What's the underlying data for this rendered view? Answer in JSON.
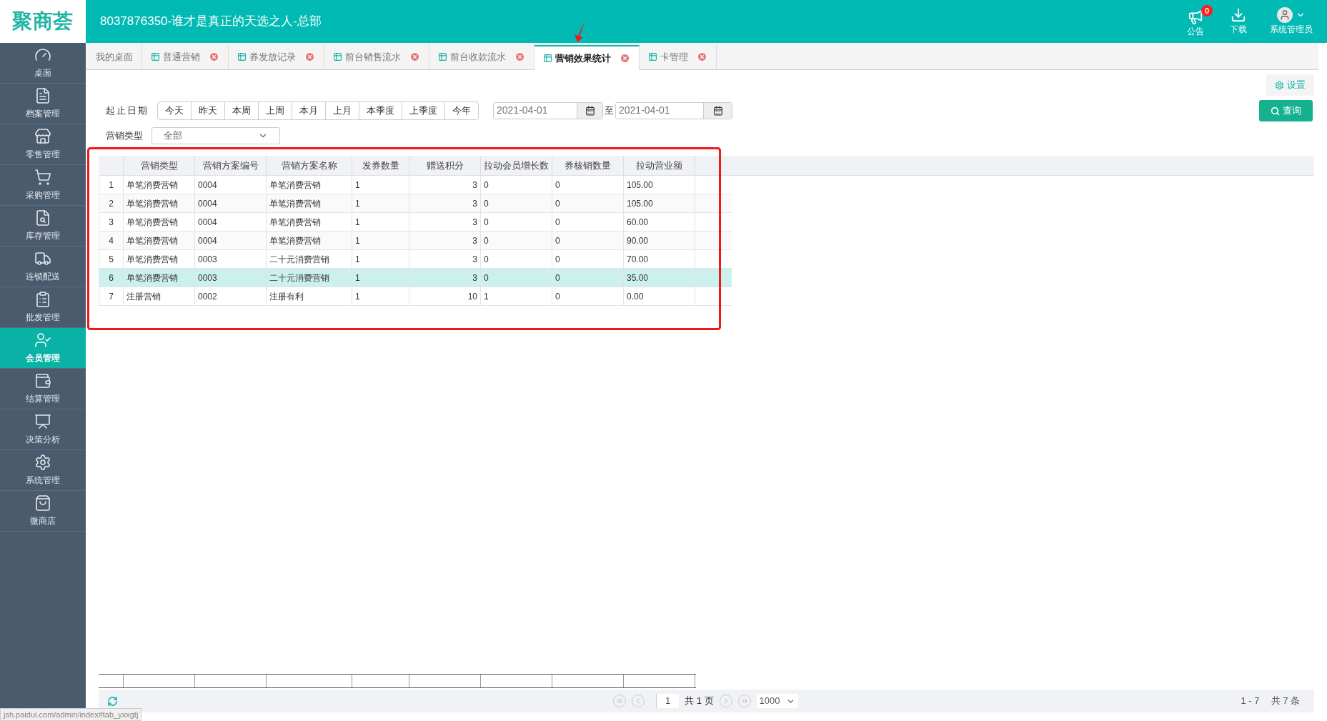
{
  "header": {
    "logo": "聚商荟",
    "title": "8037876350-谁才是真正的天选之人-总部",
    "notice": {
      "label": "公告",
      "badge": "0"
    },
    "download": "下载",
    "user": "系统管理员"
  },
  "sidebar": {
    "items": [
      {
        "label": "桌面",
        "selected": false
      },
      {
        "label": "档案管理",
        "selected": false
      },
      {
        "label": "零售管理",
        "selected": false
      },
      {
        "label": "采购管理",
        "selected": false
      },
      {
        "label": "库存管理",
        "selected": false
      },
      {
        "label": "连锁配送",
        "selected": false
      },
      {
        "label": "批发管理",
        "selected": false
      },
      {
        "label": "会员管理",
        "selected": true
      },
      {
        "label": "结算管理",
        "selected": false
      },
      {
        "label": "决策分析",
        "selected": false
      },
      {
        "label": "系统管理",
        "selected": false
      },
      {
        "label": "微商店",
        "selected": false
      }
    ]
  },
  "tabs": [
    {
      "label": "我的桌面",
      "selected": false,
      "closable": false
    },
    {
      "label": "普通营销",
      "selected": false,
      "closable": true
    },
    {
      "label": "券发放记录",
      "selected": false,
      "closable": true
    },
    {
      "label": "前台销售流水",
      "selected": false,
      "closable": true
    },
    {
      "label": "前台收款流水",
      "selected": false,
      "closable": true
    },
    {
      "label": "营销效果统计",
      "selected": true,
      "closable": true
    },
    {
      "label": "卡管理",
      "selected": false,
      "closable": true
    }
  ],
  "settings_button": "设置",
  "filters": {
    "date_label": "起止日期",
    "quick_dates": [
      "今天",
      "昨天",
      "本周",
      "上周",
      "本月",
      "上月",
      "本季度",
      "上季度",
      "今年"
    ],
    "start_date": "2021-04-01",
    "to": "至",
    "end_date": "2021-04-01",
    "type_label": "营销类型",
    "type_value": "全部",
    "query_button": "查询"
  },
  "table": {
    "columns": [
      "营销类型",
      "营销方案编号",
      "营销方案名称",
      "发券数量",
      "赠送积分",
      "拉动会员增长数",
      "券核销数量",
      "拉动营业额"
    ],
    "rows": [
      {
        "index": "1",
        "cells": [
          "单笔消费营销",
          "0004",
          "单笔消费营销",
          "1",
          "3",
          "0",
          "0",
          "105.00"
        ],
        "selected": false
      },
      {
        "index": "2",
        "cells": [
          "单笔消费营销",
          "0004",
          "单笔消费营销",
          "1",
          "3",
          "0",
          "0",
          "105.00"
        ],
        "selected": false
      },
      {
        "index": "3",
        "cells": [
          "单笔消费营销",
          "0004",
          "单笔消费营销",
          "1",
          "3",
          "0",
          "0",
          "60.00"
        ],
        "selected": false
      },
      {
        "index": "4",
        "cells": [
          "单笔消费营销",
          "0004",
          "单笔消费营销",
          "1",
          "3",
          "0",
          "0",
          "90.00"
        ],
        "selected": false
      },
      {
        "index": "5",
        "cells": [
          "单笔消费营销",
          "0003",
          "二十元消费营销",
          "1",
          "3",
          "0",
          "0",
          "70.00"
        ],
        "selected": false
      },
      {
        "index": "6",
        "cells": [
          "单笔消费营销",
          "0003",
          "二十元消费营销",
          "1",
          "3",
          "0",
          "0",
          "35.00"
        ],
        "selected": true
      },
      {
        "index": "7",
        "cells": [
          "注册营销",
          "0002",
          "注册有利",
          "1",
          "10",
          "1",
          "0",
          "0.00"
        ],
        "selected": false
      }
    ]
  },
  "pagination": {
    "page": "1",
    "total_pages": "共 1 页",
    "page_size": "1000",
    "range": "1 - 7",
    "total": "共 7 条"
  },
  "status_url": "jsh.paidui.com/admin/index#tab_yxxgtj"
}
